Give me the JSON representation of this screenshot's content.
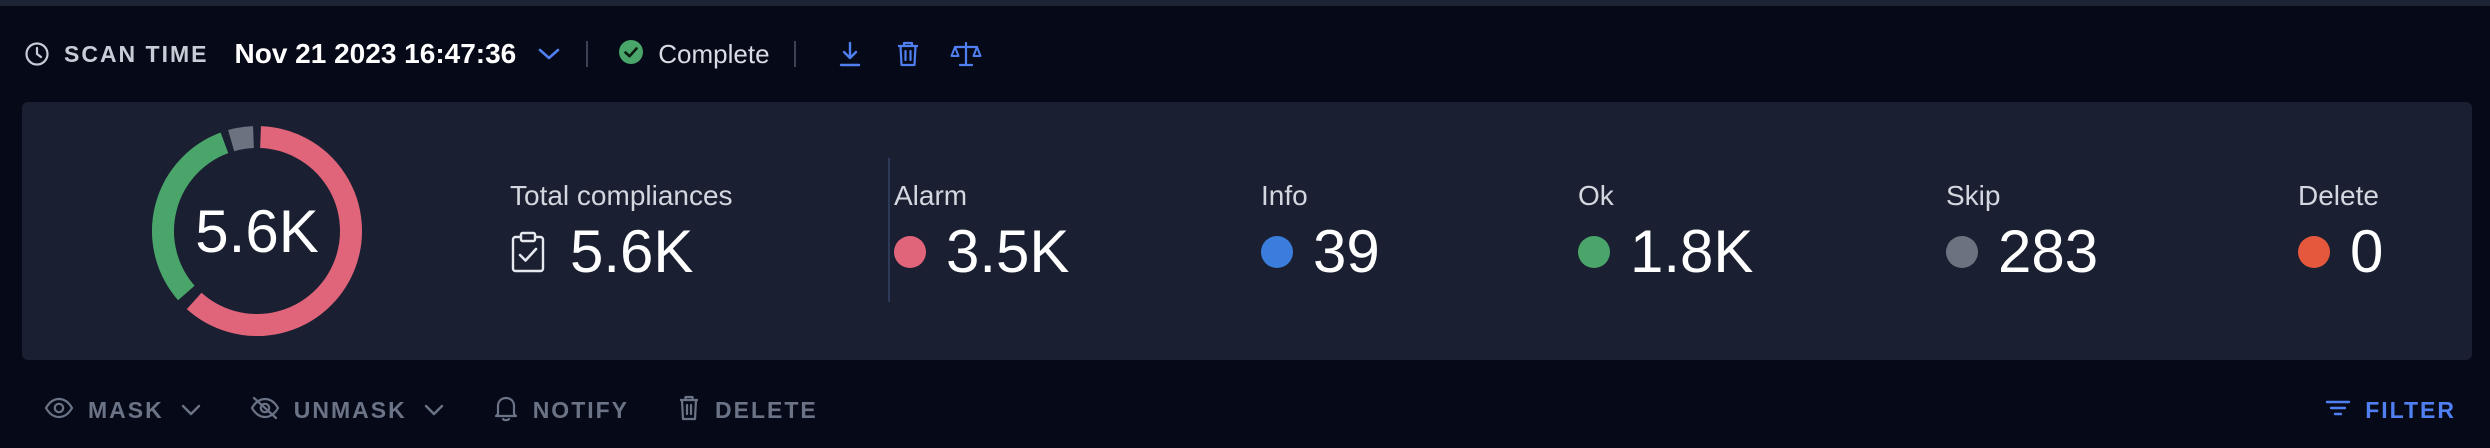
{
  "scan": {
    "label": "SCAN TIME",
    "value": "Nov 21 2023 16:47:36",
    "status": "Complete",
    "icons": [
      "clock-icon",
      "chevron-down-icon",
      "check-circle-icon",
      "download-icon",
      "trash-icon",
      "scale-icon"
    ]
  },
  "summary": {
    "donut_center": "5.6K",
    "total": {
      "label": "Total compliances",
      "value": "5.6K"
    },
    "alarm": {
      "label": "Alarm",
      "value": "3.5K",
      "color": "#e0647a"
    },
    "info": {
      "label": "Info",
      "value": "39",
      "color": "#3b7ddd"
    },
    "ok": {
      "label": "Ok",
      "value": "1.8K",
      "color": "#4aa56a"
    },
    "skip": {
      "label": "Skip",
      "value": "283",
      "color": "#6b7280"
    },
    "delete": {
      "label": "Delete",
      "value": "0",
      "color": "#e5583d"
    },
    "donut_segments": [
      {
        "name": "Alarm",
        "value": 3500,
        "color": "#e0647a"
      },
      {
        "name": "Info",
        "value": 39,
        "color": "#3b7ddd"
      },
      {
        "name": "Ok",
        "value": 1800,
        "color": "#4aa56a"
      },
      {
        "name": "Skip",
        "value": 283,
        "color": "#6b7280"
      }
    ]
  },
  "toolbar": {
    "mask": "MASK",
    "unmask": "UNMASK",
    "notify": "NOTIFY",
    "delete": "DELETE",
    "filter": "FILTER"
  },
  "colors": {
    "accent": "#4f7ff0",
    "background": "#060a18",
    "card": "#1a2031"
  }
}
